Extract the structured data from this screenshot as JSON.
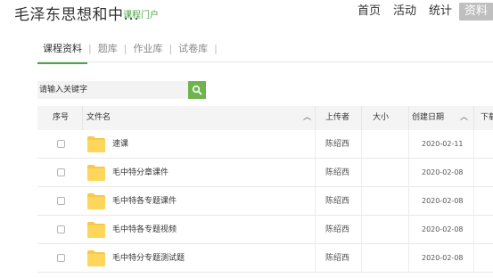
{
  "header": {
    "course_title": "毛泽东思想和中...",
    "portal_link": "课程门户",
    "nav": [
      "首页",
      "活动",
      "统计",
      "资料"
    ],
    "active_nav": "资料"
  },
  "subtabs": [
    "课程资料",
    "题库",
    "作业库",
    "试卷库"
  ],
  "active_subtab": "课程资料",
  "search": {
    "placeholder": "请输入关键字"
  },
  "table": {
    "columns": {
      "index": "序号",
      "filename": "文件名",
      "uploader": "上传者",
      "size": "大小",
      "created": "创建日期",
      "download": "下载"
    },
    "rows": [
      {
        "name": "速课",
        "uploader": "陈绍西",
        "size": "",
        "date": "2020-02-11"
      },
      {
        "name": "毛中特分章课件",
        "uploader": "陈绍西",
        "size": "",
        "date": "2020-02-08"
      },
      {
        "name": "毛中特各专题课件",
        "uploader": "陈绍西",
        "size": "",
        "date": "2020-02-08"
      },
      {
        "name": "毛中特各专题视频",
        "uploader": "陈绍西",
        "size": "",
        "date": "2020-02-08"
      },
      {
        "name": "毛中特分专题测试题",
        "uploader": "陈绍西",
        "size": "",
        "date": "2020-02-08"
      }
    ]
  },
  "colors": {
    "accent": "#4fa34a",
    "search_button": "#6fb34e",
    "folder": "#f7c948",
    "active_nav_bg": "#bfbfbf"
  }
}
